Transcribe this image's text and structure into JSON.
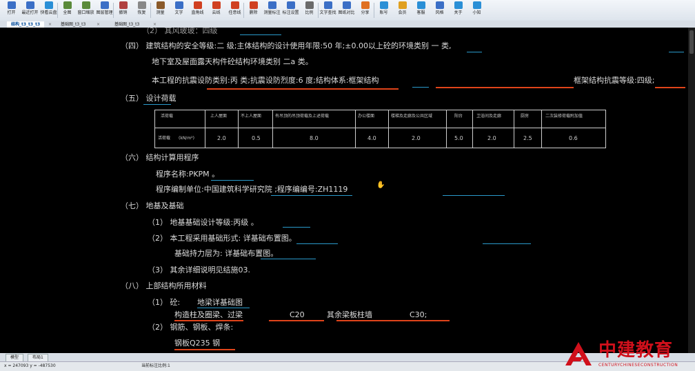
{
  "toolbar": {
    "items": [
      {
        "label": "打开",
        "color": "#3b6fc6"
      },
      {
        "label": "最近打开",
        "color": "#3b6fc6"
      },
      {
        "label": "快看云盘",
        "color": "#2a8fd6"
      },
      {
        "label": "全图",
        "color": "#5a8a3a"
      },
      {
        "label": "窗口缩放",
        "color": "#5a8a3a"
      },
      {
        "label": "图层管理",
        "color": "#3b6fc6"
      },
      {
        "label": "撤销",
        "color": "#b04040"
      },
      {
        "label": "恢复",
        "color": "#888888"
      },
      {
        "label": "测量",
        "color": "#8a5a2a"
      },
      {
        "label": "文字",
        "color": "#3b6fc6"
      },
      {
        "label": "直角线",
        "color": "#d04020"
      },
      {
        "label": "云线",
        "color": "#d04020"
      },
      {
        "label": "任意线",
        "color": "#d04020"
      },
      {
        "label": "删除",
        "color": "#d04020"
      },
      {
        "label": "测量标注",
        "color": "#3b6fc6"
      },
      {
        "label": "标注设置",
        "color": "#3b6fc6"
      },
      {
        "label": "比例",
        "color": "#6a6a6a"
      },
      {
        "label": "文字查找",
        "color": "#3b6fc6"
      },
      {
        "label": "图纸对比",
        "color": "#3b6fc6"
      },
      {
        "label": "分享",
        "color": "#e07020"
      },
      {
        "label": "账号",
        "color": "#2a8fd6"
      },
      {
        "label": "会员",
        "color": "#e0a020"
      },
      {
        "label": "客服",
        "color": "#2a8fd6"
      },
      {
        "label": "风格",
        "color": "#3b6fc6"
      },
      {
        "label": "关于",
        "color": "#2a8fd6"
      },
      {
        "label": "小知",
        "color": "#2a8fd6"
      }
    ]
  },
  "tabs": [
    {
      "label": "结构_t3_t3_t3",
      "active": true
    },
    {
      "label": "基础图_t3_t3",
      "active": false
    },
    {
      "label": "基础图_t3_t3",
      "active": false
    }
  ],
  "drawing": {
    "line0": "（2） 其风玻玻：四级",
    "line1": "（四） 建筑结构的安全等级:二 级;主体结构的设计使用年限:50 年;±0.00以上砼的环境类别 一 类,",
    "line2": "地下室及屋面露天构件砼结构环境类别 二a 类。",
    "line3": "本工程的抗震设防类别:丙 类;抗震设防烈度:6 度;结构体系:框架结构",
    "line3b": "框架结构抗震等级:四级;",
    "section5": "（五） 设计荷载",
    "section6": "（六） 结构计算用程序",
    "prog_name": "程序名称:PKPM 。",
    "prog_unit": "程序编制单位:中国建筑科学研究院 ;程序编编号:ZH1119",
    "section7": "（七） 地基及基础",
    "f1": "（1） 地基基础设计等级:丙级 。",
    "f2": "（2） 本工程采用基础形式: 详基础布置图。",
    "f2b": "基础持力层为: 详基础布置图。",
    "f3": "（3） 其余详细说明见结施03.",
    "section8": "（八） 上部结构所用材料",
    "m1": "（1） 砼:",
    "m1a": "地梁详基础图",
    "m1b": "构造柱及圈梁、过梁",
    "m1c": "C20",
    "m1d": "其余梁板柱墙",
    "m1e": "C30;",
    "m2": "（2） 钢筋、钢板、焊条:",
    "m2a": "钢板Q235 钢"
  },
  "load_table": {
    "headers": [
      "活荷载",
      "上人屋面",
      "不上人屋面",
      "有吊顶的吊顶荷载及上述荷载",
      "办公楼面",
      "楼梯及走廊及公共区域",
      "阳台",
      "卫浴间及走廊",
      "厨房",
      "二次装修荷载附加值"
    ],
    "row_label": "活荷载",
    "row_unit": "(kN/m²)",
    "values": [
      "2.0",
      "0.5",
      "8.0",
      "4.0",
      "2.0",
      "5.0",
      "2.0",
      "2.5",
      "0.6"
    ]
  },
  "bottom_tabs": [
    "模型",
    "布局1"
  ],
  "status": {
    "coords": "x = 247093 y = -487530",
    "scale": "当前标注比例:1"
  },
  "logo": {
    "name": "中建教育",
    "english": "CENTURYCHINESECONSTRUCTION"
  }
}
